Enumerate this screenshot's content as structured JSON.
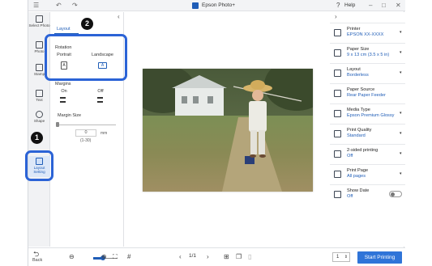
{
  "titlebar": {
    "app_title": "Epson Photo+",
    "help_label": "Help",
    "menu_icon": "hamburger-menu-icon",
    "undo_icon": "undo-icon",
    "redo_icon": "redo-icon",
    "minimize_icon": "minimize-icon",
    "maximize_icon": "maximize-icon",
    "close_icon": "close-icon"
  },
  "sidebar": {
    "items": [
      {
        "label": "Select Photo",
        "icon": "select-photo-icon"
      },
      {
        "label": "Photo",
        "icon": "photo-icon"
      },
      {
        "label": "Stamp",
        "icon": "stamp-icon"
      },
      {
        "label": "Text",
        "icon": "text-icon"
      },
      {
        "label": "Shape",
        "icon": "shape-icon"
      },
      {
        "label": "Layout Setting",
        "icon": "layout-setting-icon"
      }
    ],
    "back_label": "Back"
  },
  "panel": {
    "tab_label": "Layout",
    "rotation_label": "Rotation",
    "portrait_label": "Portrait",
    "landscape_label": "Landscape",
    "portrait_glyph": "A",
    "landscape_glyph": "A",
    "margins_label": "Margins",
    "on_label": "On",
    "off_label": "Off",
    "margin_size_label": "Margin Size",
    "margin_value": "0",
    "margin_unit": "mm",
    "margin_range": "(1-30)"
  },
  "right_panel": {
    "items": [
      {
        "title": "Printer",
        "value": "EPSON XX-XXXX",
        "icon": "printer-icon"
      },
      {
        "title": "Paper Size",
        "value": "9 x 13 cm (3.5 x 5 in)",
        "icon": "paper-size-icon"
      },
      {
        "title": "Layout",
        "value": "Borderless",
        "icon": "layout-icon"
      },
      {
        "title": "Paper Source",
        "value": "Rear Paper Feeder",
        "icon": "paper-source-icon"
      },
      {
        "title": "Media Type",
        "value": "Epson Premium Glossy",
        "icon": "media-type-icon"
      },
      {
        "title": "Print Quality",
        "value": "Standard",
        "icon": "print-quality-icon"
      },
      {
        "title": "2-sided printing",
        "value": "Off",
        "icon": "two-sided-icon"
      },
      {
        "title": "Print Page",
        "value": "All pages",
        "icon": "print-page-icon"
      },
      {
        "title": "Show Date",
        "value": "Off",
        "icon": "show-date-icon"
      }
    ]
  },
  "bottombar": {
    "page_indicator": "1/1",
    "copies_value": "1",
    "start_label": "Start Printing"
  },
  "callouts": {
    "one": "1",
    "two": "2"
  },
  "colors": {
    "accent": "#1f5db7",
    "callout": "#2b63d6",
    "start_button": "#2f74d8"
  }
}
